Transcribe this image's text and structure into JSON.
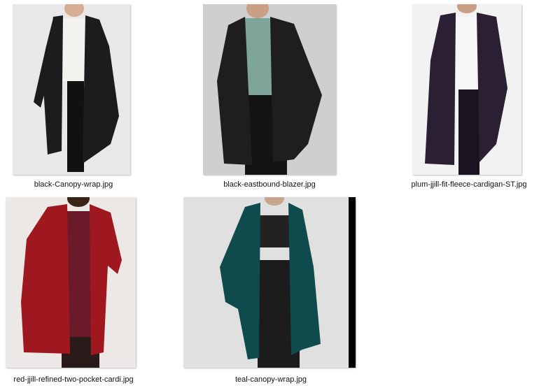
{
  "files": [
    {
      "name": "black-Canopy-wrap.jpg",
      "garment_color": "#1c1c1e",
      "top_color": "#f4f2ee",
      "bg": "#e8e8e8"
    },
    {
      "name": "black-eastbound-blazer.jpg",
      "garment_color": "#1e1e20",
      "top_color": "#7fa49a",
      "bg": "#cfcfcf"
    },
    {
      "name": "plum-jjill-fit-fleece-cardigan-ST.jpg",
      "garment_color": "#2a1f33",
      "top_color": "#f6f6f6",
      "bg": "#f2f2f2"
    },
    {
      "name": "red-jjill-refined-two-pocket-cardi.jpg",
      "garment_color": "#a0181f",
      "top_color": "#6b1a2a",
      "bg": "#ece8e6"
    },
    {
      "name": "teal-canopy-wrap.jpg",
      "garment_color": "#0f4a4c",
      "top_color": "#222222",
      "bg": "#e0e0e0"
    }
  ]
}
